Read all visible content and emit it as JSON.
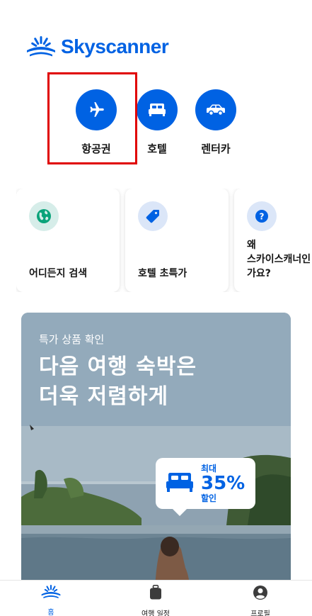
{
  "brand": {
    "name": "Skyscanner",
    "color": "#0062e3"
  },
  "services": [
    {
      "label": "항공권",
      "icon": "airplane-icon"
    },
    {
      "label": "호텔",
      "icon": "bed-icon"
    },
    {
      "label": "렌터카",
      "icon": "car-icon"
    }
  ],
  "cards": [
    {
      "label": "어디든지 검색",
      "icon": "globe-icon"
    },
    {
      "label": "호텔 초특가",
      "icon": "tag-icon"
    },
    {
      "label": "왜\n스카이스캐너인\n가요?",
      "icon": "question-icon"
    }
  ],
  "promo": {
    "eyebrow": "특가 상품 확인",
    "headline": "다음 여행 숙박은\n 더욱 저렴하게",
    "badge": {
      "top": "최대",
      "value": "35%",
      "bottom": "할인",
      "icon": "bed-icon"
    }
  },
  "bottom_nav": [
    {
      "label": "홈",
      "icon": "skyscanner-home-icon",
      "active": true
    },
    {
      "label": "여행 일정",
      "icon": "luggage-icon",
      "active": false
    },
    {
      "label": "프로필",
      "icon": "profile-icon",
      "active": false
    }
  ]
}
